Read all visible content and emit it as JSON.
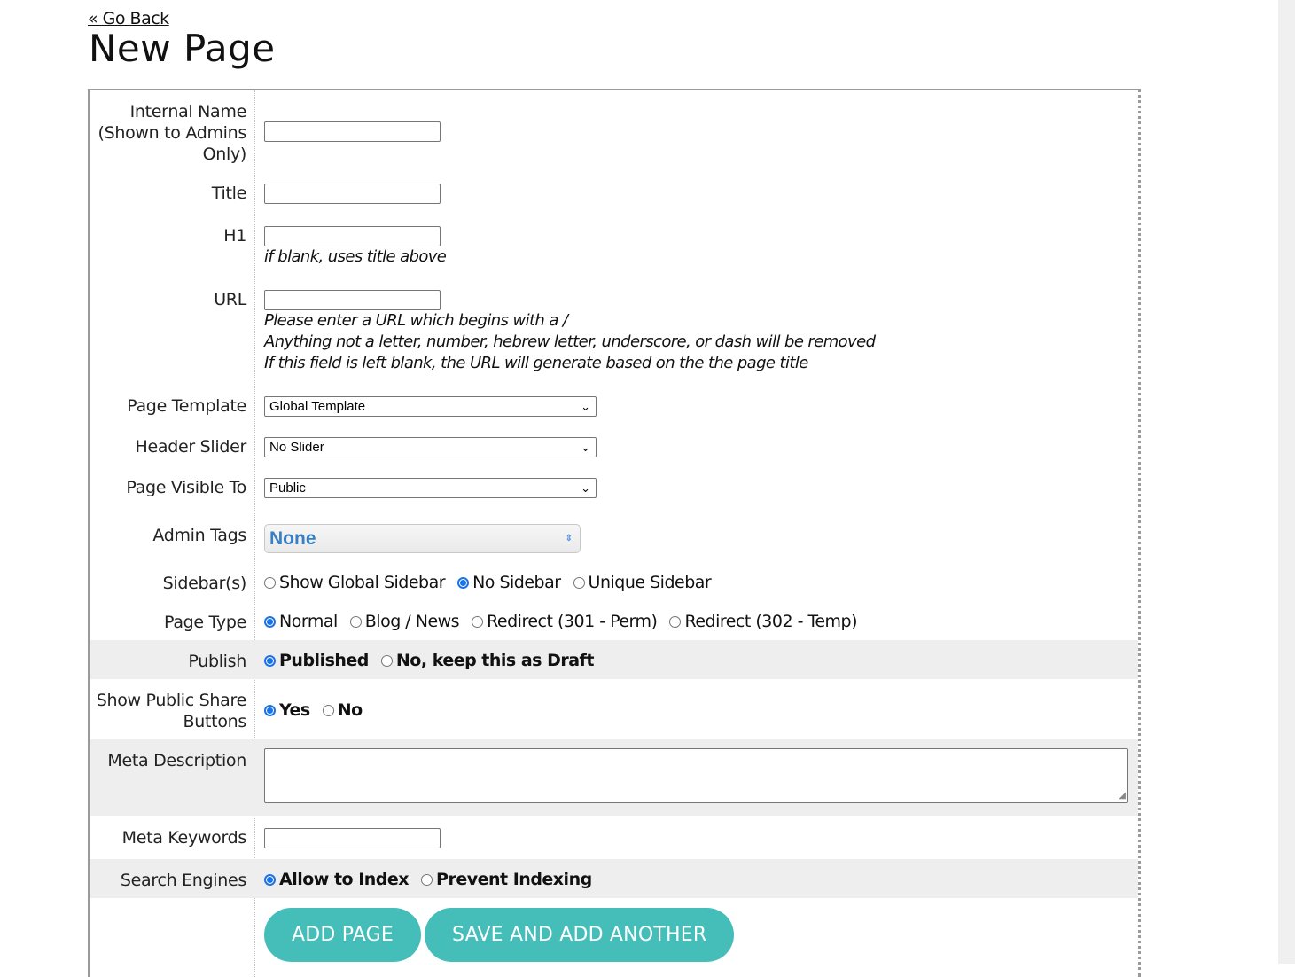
{
  "nav": {
    "go_back": "« Go Back"
  },
  "page": {
    "title": "New Page"
  },
  "fields": {
    "internal_name": {
      "label": "Internal Name (Shown to Admins Only)",
      "value": ""
    },
    "title": {
      "label": "Title",
      "value": ""
    },
    "h1": {
      "label": "H1",
      "value": "",
      "hint": "if blank, uses title above"
    },
    "url": {
      "label": "URL",
      "value": "",
      "hints": [
        "Please enter a URL which begins with a /",
        "Anything not a letter, number, hebrew letter, underscore, or dash will be removed",
        "If this field is left blank, the URL will generate based on the the page title"
      ]
    },
    "page_template": {
      "label": "Page Template",
      "selected": "Global Template"
    },
    "header_slider": {
      "label": "Header Slider",
      "selected": "No Slider"
    },
    "page_visible_to": {
      "label": "Page Visible To",
      "selected": "Public"
    },
    "admin_tags": {
      "label": "Admin Tags",
      "selected": "None"
    },
    "sidebars": {
      "label": "Sidebar(s)",
      "options": [
        "Show Global Sidebar",
        "No Sidebar",
        "Unique Sidebar"
      ],
      "selected": "No Sidebar"
    },
    "page_type": {
      "label": "Page Type",
      "options": [
        "Normal",
        "Blog / News",
        "Redirect (301 - Perm)",
        "Redirect (302 - Temp)"
      ],
      "selected": "Normal"
    },
    "publish": {
      "label": "Publish",
      "options": [
        "Published",
        "No, keep this as Draft"
      ],
      "selected": "Published"
    },
    "share_buttons": {
      "label": "Show Public Share Buttons",
      "options": [
        "Yes",
        "No"
      ],
      "selected": "Yes"
    },
    "meta_description": {
      "label": "Meta Description",
      "value": ""
    },
    "meta_keywords": {
      "label": "Meta Keywords",
      "value": ""
    },
    "search_engines": {
      "label": "Search Engines",
      "options": [
        "Allow to Index",
        "Prevent Indexing"
      ],
      "selected": "Allow to Index"
    }
  },
  "actions": {
    "add_page": "ADD PAGE",
    "save_and_add_another": "SAVE AND ADD ANOTHER"
  },
  "colors": {
    "button": "#45bdb9",
    "radio_selected": "#1a73e8",
    "tag_text": "#3a7fc4",
    "shaded_row": "#eeeeee"
  }
}
